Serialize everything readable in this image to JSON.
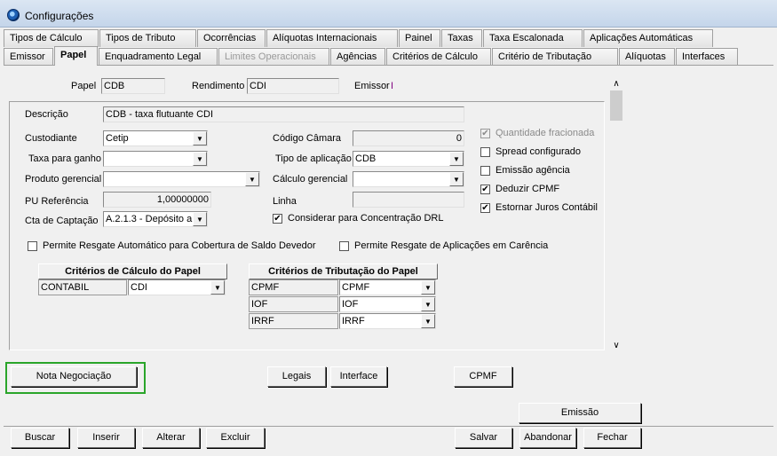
{
  "window": {
    "title": "Configurações"
  },
  "tabs_row1": [
    "Tipos de Cálculo",
    "Tipos de Tributo",
    "Ocorrências",
    "Alíquotas Internacionais",
    "Painel",
    "Taxas",
    "Taxa Escalonada",
    "Aplicações Automáticas"
  ],
  "tabs_row2": [
    "Emissor",
    "Papel",
    "Enquadramento Legal",
    "Limites Operacionais",
    "Agências",
    "Critérios de Cálculo",
    "Critério de Tributação",
    "Alíquotas",
    "Interfaces"
  ],
  "header": {
    "papel_label": "Papel",
    "papel_value": "CDB",
    "rendimento_label": "Rendimento",
    "rendimento_value": "CDI",
    "emissor_label": "Emissor",
    "emissor_value": "I"
  },
  "form": {
    "descricao_label": "Descrição",
    "descricao_value": "CDB - taxa flutuante CDI",
    "custodiante_label": "Custodiante",
    "custodiante_value": "Cetip",
    "taxa_label": "Taxa para ganho",
    "taxa_value": "",
    "produto_label": "Produto gerencial",
    "produto_value": "",
    "pu_label": "PU Referência",
    "pu_value": "1,00000000",
    "cta_label": "Cta de Captação",
    "cta_value": "A.2.1.3 - Depósito a",
    "codigo_label": "Código Câmara",
    "codigo_value": "0",
    "tipo_label": "Tipo de aplicação",
    "tipo_value": "CDB",
    "calculo_label": "Cálculo gerencial",
    "calculo_value": "",
    "linha_label": "Linha",
    "linha_value": "",
    "considerar_label": "Considerar para Concentração DRL",
    "permite_resgate_label": "Permite Resgate Automático para Cobertura de Saldo Devedor",
    "permite_carencia_label": "Permite Resgate de Aplicações em Carência"
  },
  "checkboxes": [
    {
      "label": "Quantidade fracionada",
      "checked": true,
      "mark": "✔"
    },
    {
      "label": "Spread configurado",
      "checked": false,
      "mark": ""
    },
    {
      "label": "Emissão agência",
      "checked": false,
      "mark": ""
    },
    {
      "label": "Deduzir CPMF",
      "checked": true,
      "mark": "✔"
    },
    {
      "label": "Estornar Juros Contábil",
      "checked": true,
      "mark": "✔"
    }
  ],
  "considerar_mark": "✔",
  "criterios_calculo": {
    "title": "Critérios de Cálculo do Papel",
    "row": {
      "name": "CONTABIL",
      "value": "CDI"
    }
  },
  "criterios_tributacao": {
    "title": "Critérios de Tributação do Papel",
    "rows": [
      {
        "name": "CPMF",
        "value": "CPMF"
      },
      {
        "name": "IOF",
        "value": "IOF"
      },
      {
        "name": "IRRF",
        "value": "IRRF"
      }
    ]
  },
  "buttons": {
    "nota": "Nota Negociação",
    "legais": "Legais",
    "interface": "Interface",
    "cpmf": "CPMF",
    "emissao": "Emissão",
    "buscar": "Buscar",
    "inserir": "Inserir",
    "alterar": "Alterar",
    "excluir": "Excluir",
    "salvar": "Salvar",
    "abandonar": "Abandonar",
    "fechar": "Fechar"
  },
  "icons": {
    "dropdown": "▼",
    "scroll_up": "∧",
    "scroll_down": "∨"
  }
}
